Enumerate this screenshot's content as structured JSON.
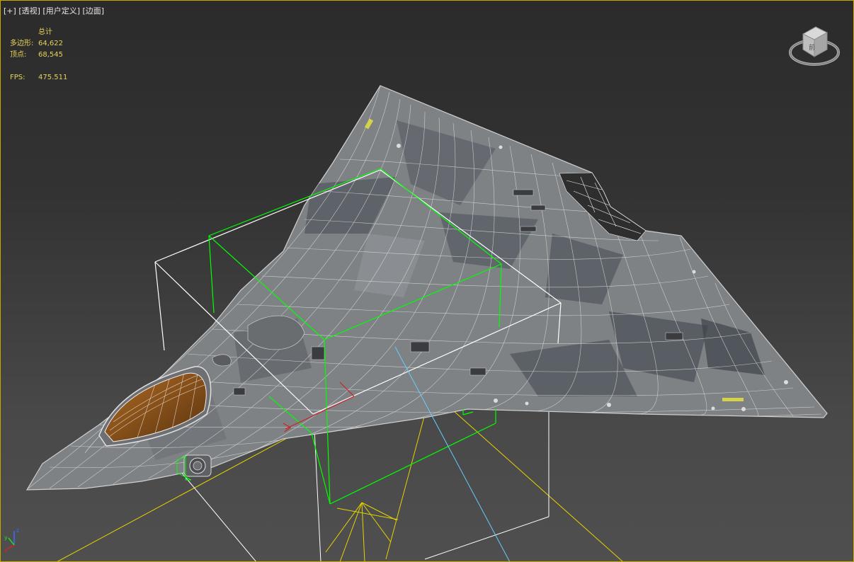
{
  "viewport": {
    "labels": [
      "[+]",
      "[透视]",
      "[用户定义]",
      "[边面]"
    ]
  },
  "stats": {
    "header": "总计",
    "rows": [
      {
        "label": "多边形:",
        "value": "64,622"
      },
      {
        "label": "顶点:",
        "value": "68,545"
      }
    ],
    "fps_label": "FPS:",
    "fps_value": "475.511"
  },
  "viewcube": {
    "face_label": "前",
    "icon": "viewcube-icon"
  },
  "axis_tripod": {
    "x": "x",
    "y": "y",
    "z": "z"
  },
  "colors": {
    "label_text": "#e6e6e6",
    "stats_text": "#e8d25a",
    "active_border": "#c8a800",
    "selection_box": "#00ff00",
    "bounding_box": "#ffffff",
    "light_lines": "#e6d200",
    "camera_target": "#66ccff"
  }
}
